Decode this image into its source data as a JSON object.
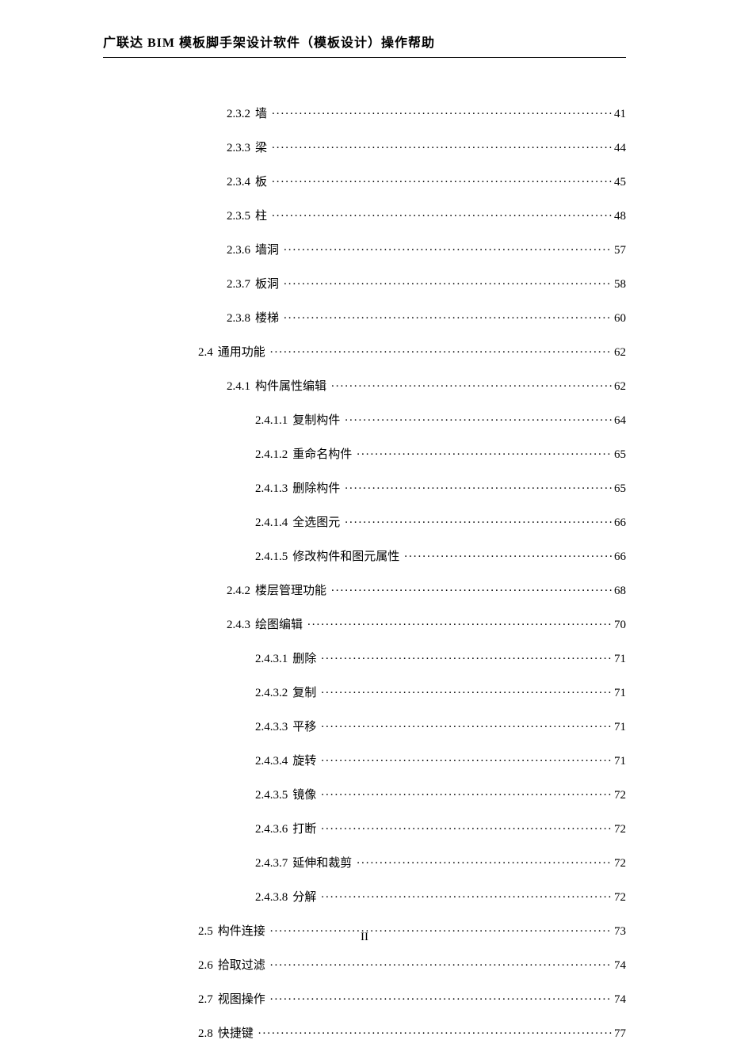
{
  "header": "广联达 BIM 模板脚手架设计软件（模板设计）操作帮助",
  "page_number": "II",
  "toc": [
    {
      "level": 2,
      "num": "2.3.2",
      "title": "墙",
      "page": "41"
    },
    {
      "level": 2,
      "num": "2.3.3",
      "title": "梁",
      "page": "44"
    },
    {
      "level": 2,
      "num": "2.3.4",
      "title": "板",
      "page": "45"
    },
    {
      "level": 2,
      "num": "2.3.5",
      "title": "柱",
      "page": "48"
    },
    {
      "level": 2,
      "num": "2.3.6",
      "title": "墙洞",
      "page": "57"
    },
    {
      "level": 2,
      "num": "2.3.7",
      "title": "板洞",
      "page": "58"
    },
    {
      "level": 2,
      "num": "2.3.8",
      "title": "楼梯",
      "page": "60"
    },
    {
      "level": 1,
      "num": "2.4",
      "title": "通用功能",
      "page": "62"
    },
    {
      "level": 2,
      "num": "2.4.1",
      "title": "构件属性编辑",
      "page": "62"
    },
    {
      "level": 3,
      "num": "2.4.1.1",
      "title": "复制构件",
      "page": "64"
    },
    {
      "level": 3,
      "num": "2.4.1.2",
      "title": "重命名构件",
      "page": "65"
    },
    {
      "level": 3,
      "num": "2.4.1.3",
      "title": "删除构件",
      "page": "65"
    },
    {
      "level": 3,
      "num": "2.4.1.4",
      "title": "全选图元",
      "page": "66"
    },
    {
      "level": 3,
      "num": "2.4.1.5",
      "title": "修改构件和图元属性",
      "page": "66"
    },
    {
      "level": 2,
      "num": "2.4.2",
      "title": "楼层管理功能",
      "page": "68"
    },
    {
      "level": 2,
      "num": "2.4.3",
      "title": "绘图编辑",
      "page": "70"
    },
    {
      "level": 3,
      "num": "2.4.3.1",
      "title": "删除",
      "page": "71"
    },
    {
      "level": 3,
      "num": "2.4.3.2",
      "title": "复制",
      "page": "71"
    },
    {
      "level": 3,
      "num": "2.4.3.3",
      "title": "平移",
      "page": "71"
    },
    {
      "level": 3,
      "num": "2.4.3.4",
      "title": "旋转",
      "page": "71"
    },
    {
      "level": 3,
      "num": "2.4.3.5",
      "title": "镜像",
      "page": "72"
    },
    {
      "level": 3,
      "num": "2.4.3.6",
      "title": "打断",
      "page": "72"
    },
    {
      "level": 3,
      "num": "2.4.3.7",
      "title": "延伸和裁剪",
      "page": "72"
    },
    {
      "level": 3,
      "num": "2.4.3.8",
      "title": "分解",
      "page": "72"
    },
    {
      "level": 1,
      "num": "2.5",
      "title": "构件连接",
      "page": "73"
    },
    {
      "level": 1,
      "num": "2.6",
      "title": "拾取过滤",
      "page": "74"
    },
    {
      "level": 1,
      "num": "2.7",
      "title": "视图操作",
      "page": "74"
    },
    {
      "level": 1,
      "num": "2.8",
      "title": "快捷键",
      "page": "77"
    }
  ]
}
